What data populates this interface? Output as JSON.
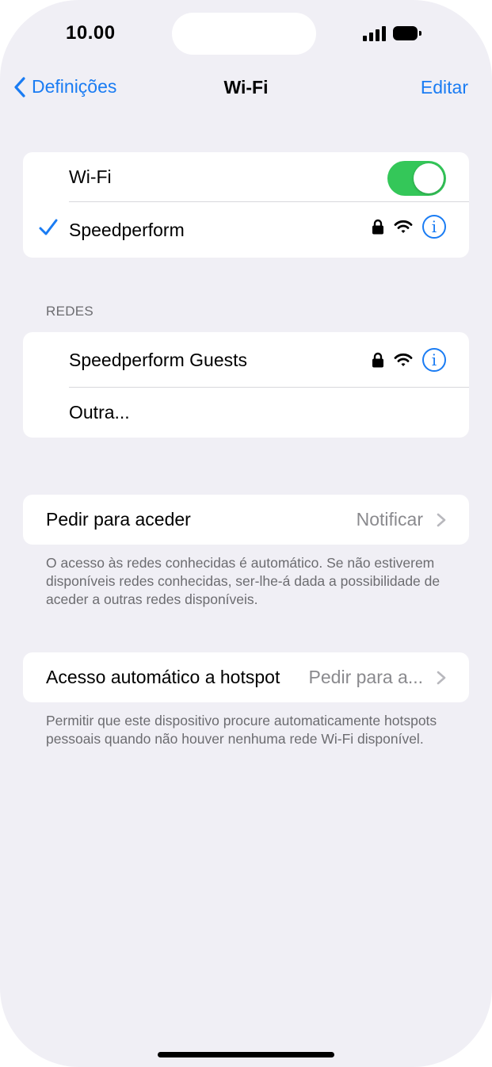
{
  "status": {
    "time": "10.00"
  },
  "nav": {
    "back_label": "Definições",
    "title": "Wi-Fi",
    "edit_label": "Editar"
  },
  "wifi_group": {
    "toggle_label": "Wi-Fi",
    "toggle_on": true,
    "connected_network": "Speedperform"
  },
  "networks": {
    "header": "REDES",
    "items": [
      {
        "name": "Speedperform Guests"
      },
      {
        "name": "Outra..."
      }
    ]
  },
  "ask_to_join": {
    "label": "Pedir para aceder",
    "value": "Notificar",
    "footer": "O acesso às redes conhecidas é automático. Se não estiverem disponíveis redes conhecidas, ser-lhe-á dada a possibilidade de aceder a outras redes disponíveis."
  },
  "hotspot": {
    "label": "Acesso automático a hotspot",
    "value": "Pedir para a...",
    "footer": "Permitir que este dispositivo procure automaticamente hotspots pessoais quando não houver nenhuma rede Wi-Fi disponível."
  },
  "icons": {
    "back": "chevron-left-icon",
    "check": "checkmark-icon",
    "lock": "lock-icon",
    "wifi": "wifi-icon",
    "info": "info-icon",
    "chevron": "chevron-right-icon"
  },
  "colors": {
    "accent": "#1a7cf3",
    "toggle_on": "#34c759",
    "background": "#f0eff5"
  }
}
